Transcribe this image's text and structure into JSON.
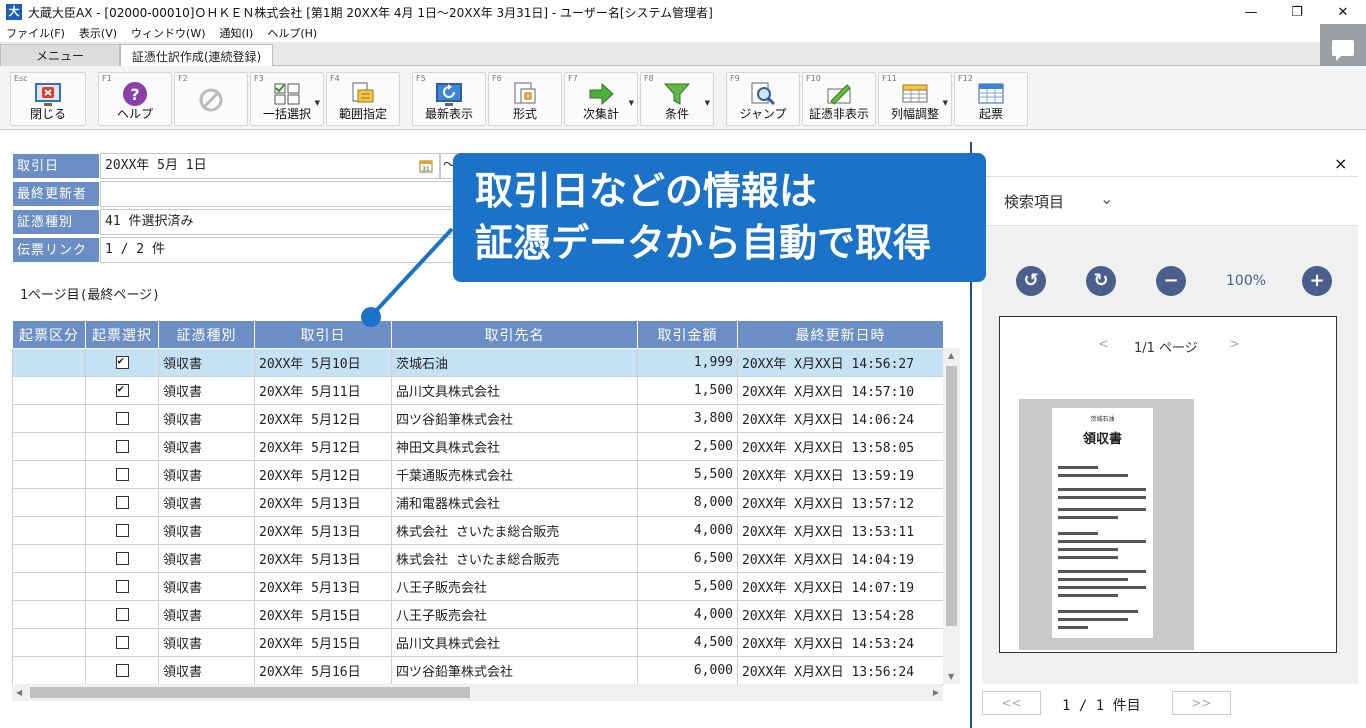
{
  "window": {
    "app_icon": "大",
    "title": "大蔵大臣AX - [02000-00010]ＯＨＫＥＮ株式会社 [第1期 20XX年 4月 1日～20XX年 3月31日] - ユーザー名[システム管理者]",
    "minimize": "—",
    "restore": "❐",
    "close": "✕"
  },
  "menu": [
    "ファイル(F)",
    "表示(V)",
    "ウィンドウ(W)",
    "通知(I)",
    "ヘルプ(H)"
  ],
  "tabs": [
    "メニュー",
    "証憑仕訳作成(連続登録)"
  ],
  "toolbar": [
    {
      "key": "Esc",
      "label": "閉じる",
      "icon": "close-window-icon"
    },
    {
      "key": "F1",
      "label": "ヘルプ",
      "icon": "help-icon"
    },
    {
      "key": "F2",
      "label": "",
      "icon": "disabled-icon"
    },
    {
      "key": "F3",
      "label": "一括選択",
      "icon": "checklist-icon"
    },
    {
      "key": "F4",
      "label": "範囲指定",
      "icon": "range-icon"
    },
    {
      "key": "F5",
      "label": "最新表示",
      "icon": "refresh-icon"
    },
    {
      "key": "F6",
      "label": "形式",
      "icon": "format-icon"
    },
    {
      "key": "F7",
      "label": "次集計",
      "icon": "next-arrow-icon"
    },
    {
      "key": "F8",
      "label": "条件",
      "icon": "filter-icon"
    },
    {
      "key": "F9",
      "label": "ジャンプ",
      "icon": "jump-search-icon"
    },
    {
      "key": "F10",
      "label": "証憑非表示",
      "icon": "hide-voucher-icon"
    },
    {
      "key": "F11",
      "label": "列幅調整",
      "icon": "column-width-icon"
    },
    {
      "key": "F12",
      "label": "起票",
      "icon": "post-entry-icon"
    }
  ],
  "form": {
    "date_label": "取引日",
    "date_value": "20XX年 5月 1日",
    "date_tilde": "～",
    "updater_label": "最終更新者",
    "updater_value": "",
    "voucher_type_label": "証憑種別",
    "voucher_type_value": "41 件選択済み",
    "slip_link_label": "伝票リンク",
    "slip_link_value": "1 / 2 件"
  },
  "page_info": "1ページ目(最終ページ)",
  "table": {
    "headers": [
      "起票区分",
      "起票選択",
      "証憑種別",
      "取引日",
      "取引先名",
      "取引金額",
      "最終更新日時"
    ],
    "rows": [
      {
        "kubun": "",
        "checked": true,
        "type": "領収書",
        "date": "20XX年 5月10日",
        "partner": "茨城石油",
        "amount": "1,999",
        "updated": "20XX年 X月XX日 14:56:27",
        "selected": true
      },
      {
        "kubun": "",
        "checked": true,
        "type": "領収書",
        "date": "20XX年 5月11日",
        "partner": "品川文具株式会社",
        "amount": "1,500",
        "updated": "20XX年 X月XX日 14:57:10",
        "selected": false
      },
      {
        "kubun": "",
        "checked": false,
        "type": "領収書",
        "date": "20XX年 5月12日",
        "partner": "四ツ谷鉛筆株式会社",
        "amount": "3,800",
        "updated": "20XX年 X月XX日 14:06:24",
        "selected": false
      },
      {
        "kubun": "",
        "checked": false,
        "type": "領収書",
        "date": "20XX年 5月12日",
        "partner": "神田文具株式会社",
        "amount": "2,500",
        "updated": "20XX年 X月XX日 13:58:05",
        "selected": false
      },
      {
        "kubun": "",
        "checked": false,
        "type": "領収書",
        "date": "20XX年 5月12日",
        "partner": "千葉通販売株式会社",
        "amount": "5,500",
        "updated": "20XX年 X月XX日 13:59:19",
        "selected": false
      },
      {
        "kubun": "",
        "checked": false,
        "type": "領収書",
        "date": "20XX年 5月13日",
        "partner": "浦和電器株式会社",
        "amount": "8,000",
        "updated": "20XX年 X月XX日 13:57:12",
        "selected": false
      },
      {
        "kubun": "",
        "checked": false,
        "type": "領収書",
        "date": "20XX年 5月13日",
        "partner": "株式会社 さいたま総合販売",
        "amount": "4,000",
        "updated": "20XX年 X月XX日 13:53:11",
        "selected": false
      },
      {
        "kubun": "",
        "checked": false,
        "type": "領収書",
        "date": "20XX年 5月13日",
        "partner": "株式会社 さいたま総合販売",
        "amount": "6,500",
        "updated": "20XX年 X月XX日 14:04:19",
        "selected": false
      },
      {
        "kubun": "",
        "checked": false,
        "type": "領収書",
        "date": "20XX年 5月13日",
        "partner": "八王子販売会社",
        "amount": "5,500",
        "updated": "20XX年 X月XX日 14:07:19",
        "selected": false
      },
      {
        "kubun": "",
        "checked": false,
        "type": "領収書",
        "date": "20XX年 5月15日",
        "partner": "八王子販売会社",
        "amount": "4,000",
        "updated": "20XX年 X月XX日 13:54:28",
        "selected": false
      },
      {
        "kubun": "",
        "checked": false,
        "type": "領収書",
        "date": "20XX年 5月15日",
        "partner": "品川文具株式会社",
        "amount": "4,500",
        "updated": "20XX年 X月XX日 14:53:24",
        "selected": false
      },
      {
        "kubun": "",
        "checked": false,
        "type": "領収書",
        "date": "20XX年 5月16日",
        "partner": "四ツ谷鉛筆株式会社",
        "amount": "6,000",
        "updated": "20XX年 X月XX日 13:56:24",
        "selected": false
      }
    ]
  },
  "right_panel": {
    "close": "×",
    "search_label": "検索項目",
    "search_chevron": "⌄",
    "rotate_left": "↺",
    "rotate_right": "↻",
    "zoom_out": "−",
    "zoom_in": "+",
    "zoom_level": "100%",
    "pager_prev": "<",
    "pager_text": "1/1 ページ",
    "pager_next": ">",
    "receipt_shop": "茨城石油",
    "receipt_title": "領収書",
    "nav_first": "<<",
    "nav_last": ">>",
    "page_count": "1 /  1 件目"
  },
  "callout": {
    "line1": "取引日などの情報は",
    "line2": "証憑データから自動で取得"
  },
  "colors": {
    "header_blue": "#6b8fc4",
    "selected_row": "#c5e2f4",
    "callout_blue": "#1a73c8",
    "divider": "#2c4a8c"
  }
}
